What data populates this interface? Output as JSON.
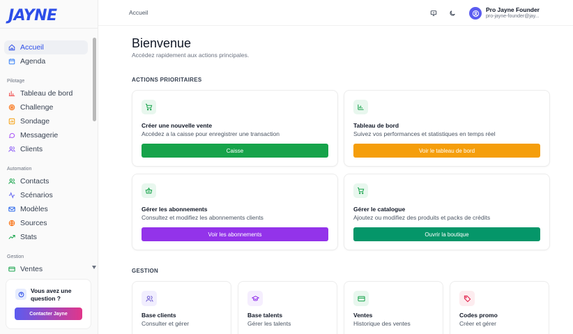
{
  "app": {
    "logo": "JAYNE"
  },
  "sidebar": {
    "main_items": [
      {
        "label": "Accueil",
        "icon": "home-icon",
        "active": true
      },
      {
        "label": "Agenda",
        "icon": "calendar-icon"
      }
    ],
    "sections": [
      {
        "title": "Pilotage",
        "items": [
          {
            "label": "Tableau de bord",
            "icon": "bar-chart-icon"
          },
          {
            "label": "Challenge",
            "icon": "target-icon"
          },
          {
            "label": "Sondage",
            "icon": "poll-icon"
          },
          {
            "label": "Messagerie",
            "icon": "message-icon"
          },
          {
            "label": "Clients",
            "icon": "users-icon"
          }
        ]
      },
      {
        "title": "Automation",
        "items": [
          {
            "label": "Contacts",
            "icon": "contacts-icon"
          },
          {
            "label": "Scénarios",
            "icon": "activity-icon"
          },
          {
            "label": "Modèles",
            "icon": "mail-icon"
          },
          {
            "label": "Sources",
            "icon": "globe-icon"
          },
          {
            "label": "Stats",
            "icon": "trending-up-icon"
          }
        ]
      },
      {
        "title": "Gestion",
        "items": [
          {
            "label": "Ventes",
            "icon": "credit-card-icon"
          }
        ]
      }
    ],
    "help": {
      "question": "Vous avez une question ?",
      "button": "Contacter Jayne"
    }
  },
  "topbar": {
    "breadcrumb": "Accueil",
    "user": {
      "name": "Pro Jayne Founder",
      "email": "pro-jayne-founder@jay..."
    }
  },
  "main": {
    "title": "Bienvenue",
    "subtitle": "Accédez rapidement aux actions principales.",
    "priority_title": "ACTIONS PRIORITAIRES",
    "priority_cards": [
      {
        "title": "Créer une nouvelle vente",
        "subtitle": "Accédez a la caisse pour enregistrer une transaction",
        "button": "Caisse",
        "color": "#16a34a",
        "icon": "cart-icon",
        "icon_bg": "#e8f7ee",
        "icon_color": "#16a34a"
      },
      {
        "title": "Tableau de bord",
        "subtitle": "Suivez vos performances et statistiques en temps réel",
        "button": "Voir le tableau de bord",
        "color": "#f59e0b",
        "icon": "bar-chart-icon",
        "icon_bg": "#e8f7ee",
        "icon_color": "#16a34a"
      },
      {
        "title": "Gérer les abonnements",
        "subtitle": "Consultez et modifiez les abonnements clients",
        "button": "Voir les abonnements",
        "color": "#9333ea",
        "icon": "basket-icon",
        "icon_bg": "#e8f7ee",
        "icon_color": "#16a34a"
      },
      {
        "title": "Gérer le catalogue",
        "subtitle": "Ajoutez ou modifiez des produits et packs de crédits",
        "button": "Ouvrir la boutique",
        "color": "#059669",
        "icon": "cart-icon",
        "icon_bg": "#e8f7ee",
        "icon_color": "#16a34a"
      }
    ],
    "gestion_title": "GESTION",
    "gestion_cards": [
      {
        "title": "Base clients",
        "subtitle": "Consulter et gérer",
        "icon": "users-icon",
        "icon_bg": "#f1eefe",
        "icon_color": "#6d5bd0"
      },
      {
        "title": "Base talents",
        "subtitle": "Gérer les talents",
        "icon": "graduation-cap-icon",
        "icon_bg": "#f5eefe",
        "icon_color": "#9333ea"
      },
      {
        "title": "Ventes",
        "subtitle": "Historique des ventes",
        "icon": "credit-card-icon",
        "icon_bg": "#e8f7ee",
        "icon_color": "#16a34a"
      },
      {
        "title": "Codes promo",
        "subtitle": "Créer et gérer",
        "icon": "tag-icon",
        "icon_bg": "#fdecef",
        "icon_color": "#e11d48"
      }
    ]
  }
}
